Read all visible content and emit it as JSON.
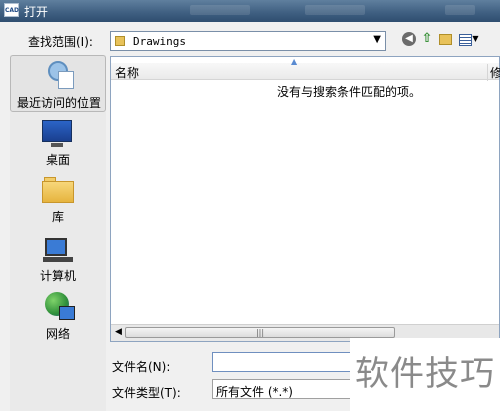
{
  "window": {
    "title": "打开",
    "app_icon_text": "CAD"
  },
  "look_in": {
    "label": "查找范围(I):",
    "value": "Drawings"
  },
  "places": [
    {
      "label": "最近访问的位置",
      "icon": "recent-places-icon"
    },
    {
      "label": "桌面",
      "icon": "desktop-icon"
    },
    {
      "label": "库",
      "icon": "libraries-icon"
    },
    {
      "label": "计算机",
      "icon": "computer-icon"
    },
    {
      "label": "网络",
      "icon": "network-icon"
    }
  ],
  "file_list": {
    "columns": [
      "名称",
      "修"
    ],
    "empty_message": "没有与搜索条件匹配的项。"
  },
  "file_name": {
    "label": "文件名(N):",
    "value": ""
  },
  "file_type": {
    "label": "文件类型(T):",
    "value": "所有文件 (*.*)"
  },
  "watermark": "软件技巧",
  "colors": {
    "title_bar": "#3e5e80",
    "list_border": "#8ea4c0",
    "folder": "#e8c25a"
  }
}
